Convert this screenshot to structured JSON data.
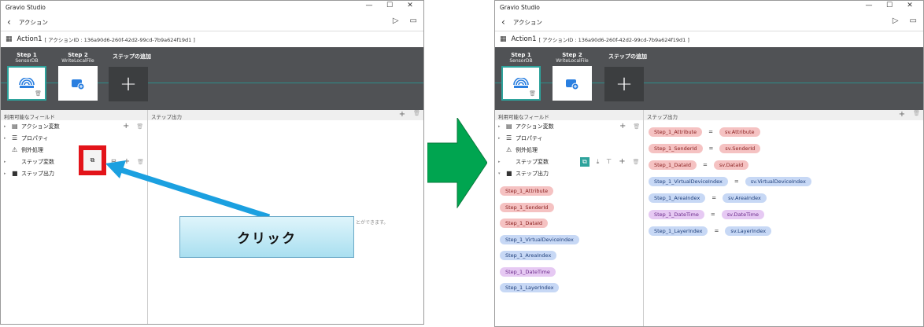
{
  "app_title": "Gravio Studio",
  "nav_title": "アクション",
  "action": {
    "name": "Action1",
    "id_label": "[ アクションID : 136a90d6-260f-42d2-99cd-7b9a624f19d1 ]"
  },
  "steps": [
    {
      "title": "Step 1",
      "sub": "SensorDB"
    },
    {
      "title": "Step 2",
      "sub": "WriteLocalFile"
    }
  ],
  "add_step_label": "ステップの追加",
  "left_pane_header": "利用可能なフィールド",
  "right_pane_header": "ステップ出力",
  "fields": [
    {
      "label": "アクション変数",
      "icon": "list-icon"
    },
    {
      "label": "プロパティ",
      "icon": "properties-icon"
    },
    {
      "label": "例外処理",
      "icon": "warning-icon"
    },
    {
      "label": "ステップ変数",
      "icon": ""
    },
    {
      "label": "ステップ出力",
      "icon": "video-icon"
    }
  ],
  "callout_text": "クリック",
  "hint_text": "とができます。",
  "step_output_chips": [
    {
      "label": "Step_1_Attribute",
      "color": "pink"
    },
    {
      "label": "Step_1_SenderId",
      "color": "pink"
    },
    {
      "label": "Step_1_DataId",
      "color": "pink"
    },
    {
      "label": "Step_1_VirtualDeviceIndex",
      "color": "blue"
    },
    {
      "label": "Step_1_AreaIndex",
      "color": "blue"
    },
    {
      "label": "Step_1_DateTime",
      "color": "purple"
    },
    {
      "label": "Step_1_LayerIndex",
      "color": "blue"
    }
  ],
  "mappings": [
    {
      "left": "Step_1_Attribute",
      "right": "sv.Attribute",
      "color": "pink"
    },
    {
      "left": "Step_1_SenderId",
      "right": "sv.SenderId",
      "color": "pink"
    },
    {
      "left": "Step_1_DataId",
      "right": "sv.DataId",
      "color": "pink"
    },
    {
      "left": "Step_1_VirtualDeviceIndex",
      "right": "sv.VirtualDeviceIndex",
      "color": "blue"
    },
    {
      "left": "Step_1_AreaIndex",
      "right": "sv.AreaIndex",
      "color": "blue"
    },
    {
      "left": "Step_1_DateTime",
      "right": "sv.DateTime",
      "color": "purple"
    },
    {
      "left": "Step_1_LayerIndex",
      "right": "sv.LayerIndex",
      "color": "blue"
    }
  ],
  "equals": "="
}
